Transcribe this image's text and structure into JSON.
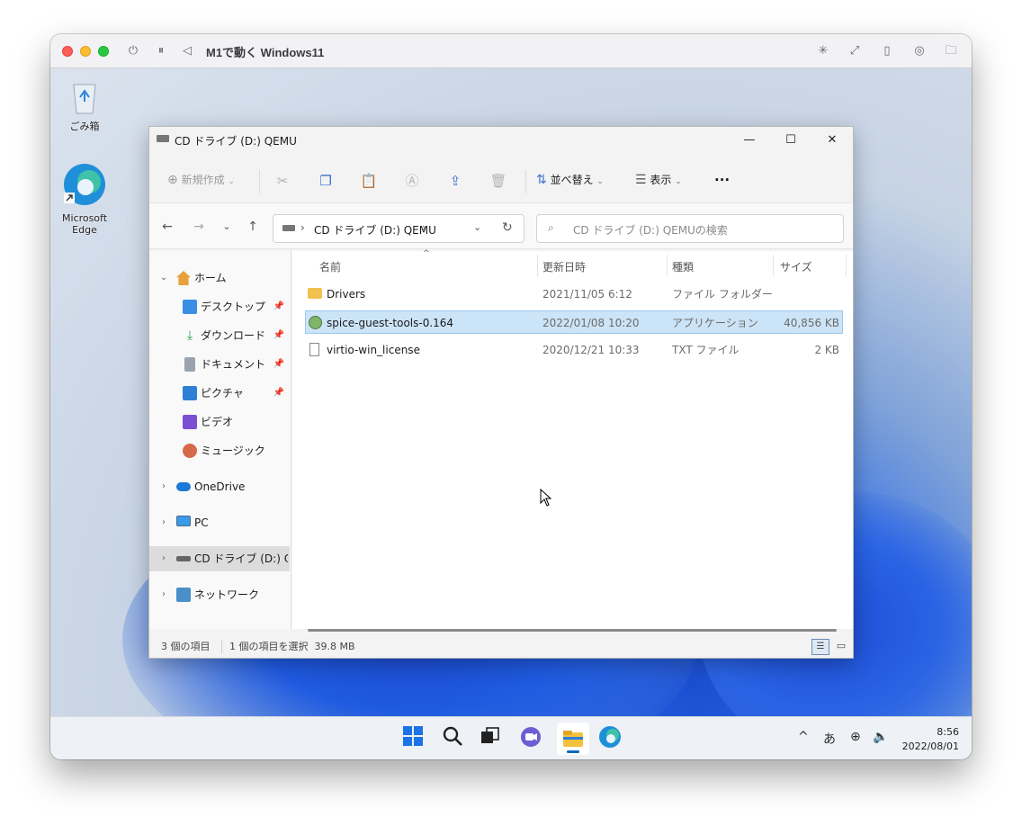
{
  "vm_window": {
    "title": "M1で動く Windows11",
    "icons": [
      "power-icon",
      "pause-icon",
      "back-icon",
      "brightness-icon",
      "resize-icon",
      "usb-icon",
      "shared-icon",
      "folder-icon"
    ]
  },
  "desktop_icons": [
    {
      "label": "ごみ箱",
      "icon": "recycle-bin-icon"
    },
    {
      "label": "Microsoft Edge",
      "icon": "edge-icon"
    }
  ],
  "explorer": {
    "title": "CD ドライブ (D:) QEMU",
    "toolbar": {
      "new_label": "新規作成",
      "sort_label": "並べ替え",
      "view_label": "表示",
      "more_label": "···"
    },
    "address": {
      "segment": "CD ドライブ (D:) QEMU"
    },
    "search_placeholder": "CD ドライブ (D:) QEMUの検索",
    "sidebar": [
      {
        "label": "ホーム",
        "icon": "home-icon",
        "pinned": false
      },
      {
        "label": "デスクトップ",
        "icon": "desktop-icon",
        "pinned": true
      },
      {
        "label": "ダウンロード",
        "icon": "download-icon",
        "pinned": true
      },
      {
        "label": "ドキュメント",
        "icon": "document-icon",
        "pinned": true
      },
      {
        "label": "ピクチャ",
        "icon": "picture-icon",
        "pinned": true
      },
      {
        "label": "ビデオ",
        "icon": "video-icon",
        "pinned": false
      },
      {
        "label": "ミュージック",
        "icon": "music-icon",
        "pinned": false
      },
      {
        "label": "OneDrive",
        "icon": "onedrive-icon",
        "pinned": false
      },
      {
        "label": "PC",
        "icon": "pc-icon",
        "pinned": false
      },
      {
        "label": "CD ドライブ (D:) QEMU",
        "icon": "cd-drive-icon",
        "pinned": false
      },
      {
        "label": "ネットワーク",
        "icon": "network-icon",
        "pinned": false
      }
    ],
    "columns": {
      "name": "名前",
      "date": "更新日時",
      "type": "種類",
      "size": "サイズ"
    },
    "files": [
      {
        "name": "Drivers",
        "date": "2021/11/05 6:12",
        "type": "ファイル フォルダー",
        "size": "",
        "icon": "folder-icon"
      },
      {
        "name": "spice-guest-tools-0.164",
        "date": "2022/01/08 10:20",
        "type": "アプリケーション",
        "size": "40,856 KB",
        "icon": "application-icon"
      },
      {
        "name": "virtio-win_license",
        "date": "2020/12/21 10:33",
        "type": "TXT ファイル",
        "size": "2 KB",
        "icon": "text-file-icon"
      }
    ],
    "status": {
      "count": "3 個の項目",
      "selection": "1 個の項目を選択  39.8 MB"
    }
  },
  "taskbar": {
    "ime": "あ",
    "time": "8:56",
    "date": "2022/08/01"
  },
  "colors": {
    "accent": "#0067c0",
    "selection": "#cce4f7",
    "mac_red": "#ff5f57",
    "mac_yellow": "#febc2e",
    "mac_green": "#28c840"
  }
}
